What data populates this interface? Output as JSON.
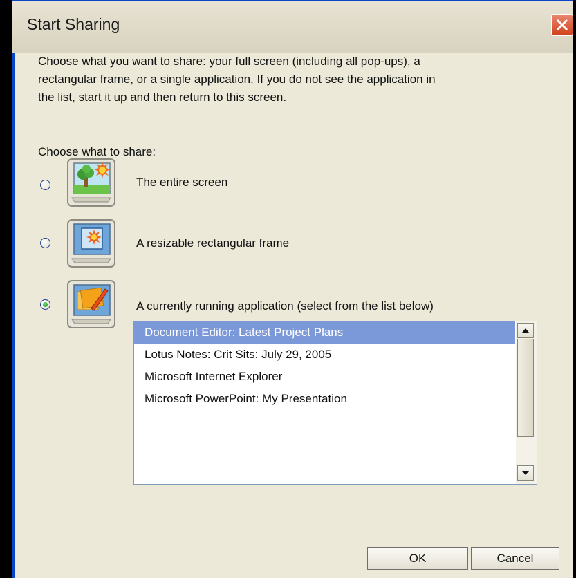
{
  "dialog": {
    "title": "Start Sharing",
    "close_icon": "close-icon"
  },
  "description": {
    "lines": [
      "Choose what you want to share: your full screen (including all pop-ups), a",
      "rectangular frame, or a single application.  If you do not see the application in",
      "the list, start it up and then return to this screen."
    ]
  },
  "choose_label": "Choose what to share:",
  "options": [
    {
      "label": "The entire screen",
      "icon": "monitor-tree-sun-icon",
      "selected": false
    },
    {
      "label": "A resizable rectangular frame",
      "icon": "monitor-frame-icon",
      "selected": false
    },
    {
      "label": "A currently running application (select from the list below)",
      "icon": "monitor-application-icon",
      "selected": true
    }
  ],
  "app_list": {
    "items": [
      "Document Editor: Latest Project Plans",
      "Lotus Notes: Crit Sits: July 29, 2005",
      "Microsoft Internet Explorer",
      "Microsoft PowerPoint: My Presentation"
    ],
    "selected_index": 0
  },
  "buttons": {
    "ok": "OK",
    "cancel": "Cancel"
  },
  "colors": {
    "window_border": "#0844c8",
    "dialog_bg": "#ece9d8",
    "close_button": "#d0411d",
    "selection": "#7b98d8"
  }
}
